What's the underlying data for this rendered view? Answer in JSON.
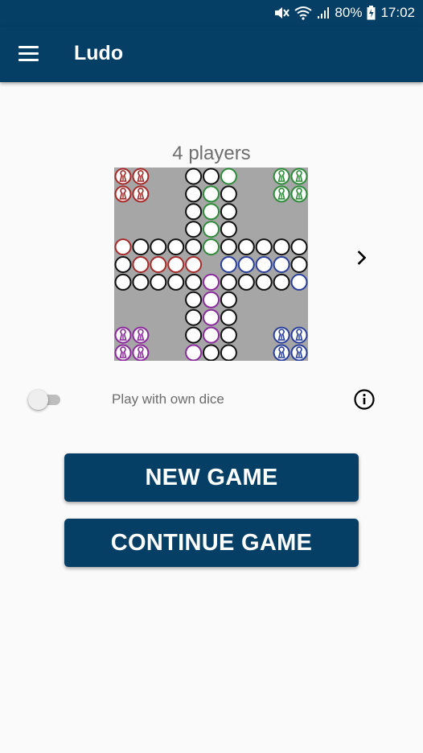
{
  "status_bar": {
    "battery_percent": "80%",
    "time": "17:02",
    "icons": [
      "mute-icon",
      "wifi-icon",
      "signal-icon",
      "battery-icon"
    ]
  },
  "app_bar": {
    "title": "Ludo",
    "menu_icon": "hamburger-menu-icon"
  },
  "board": {
    "players_label": "4 players",
    "player_count": 4,
    "colors": {
      "background": "#a6a6a6",
      "red": "#a52a2a",
      "green": "#2e8b3a",
      "blue": "#2a3f9a",
      "purple": "#8a2a9c",
      "neutral": "#111111"
    },
    "next_icon": "chevron-right-icon"
  },
  "options": {
    "own_dice_label": "Play with own dice",
    "own_dice_enabled": false,
    "info_icon": "info-icon"
  },
  "buttons": {
    "new_game": "NEW GAME",
    "continue_game": "CONTINUE GAME"
  }
}
